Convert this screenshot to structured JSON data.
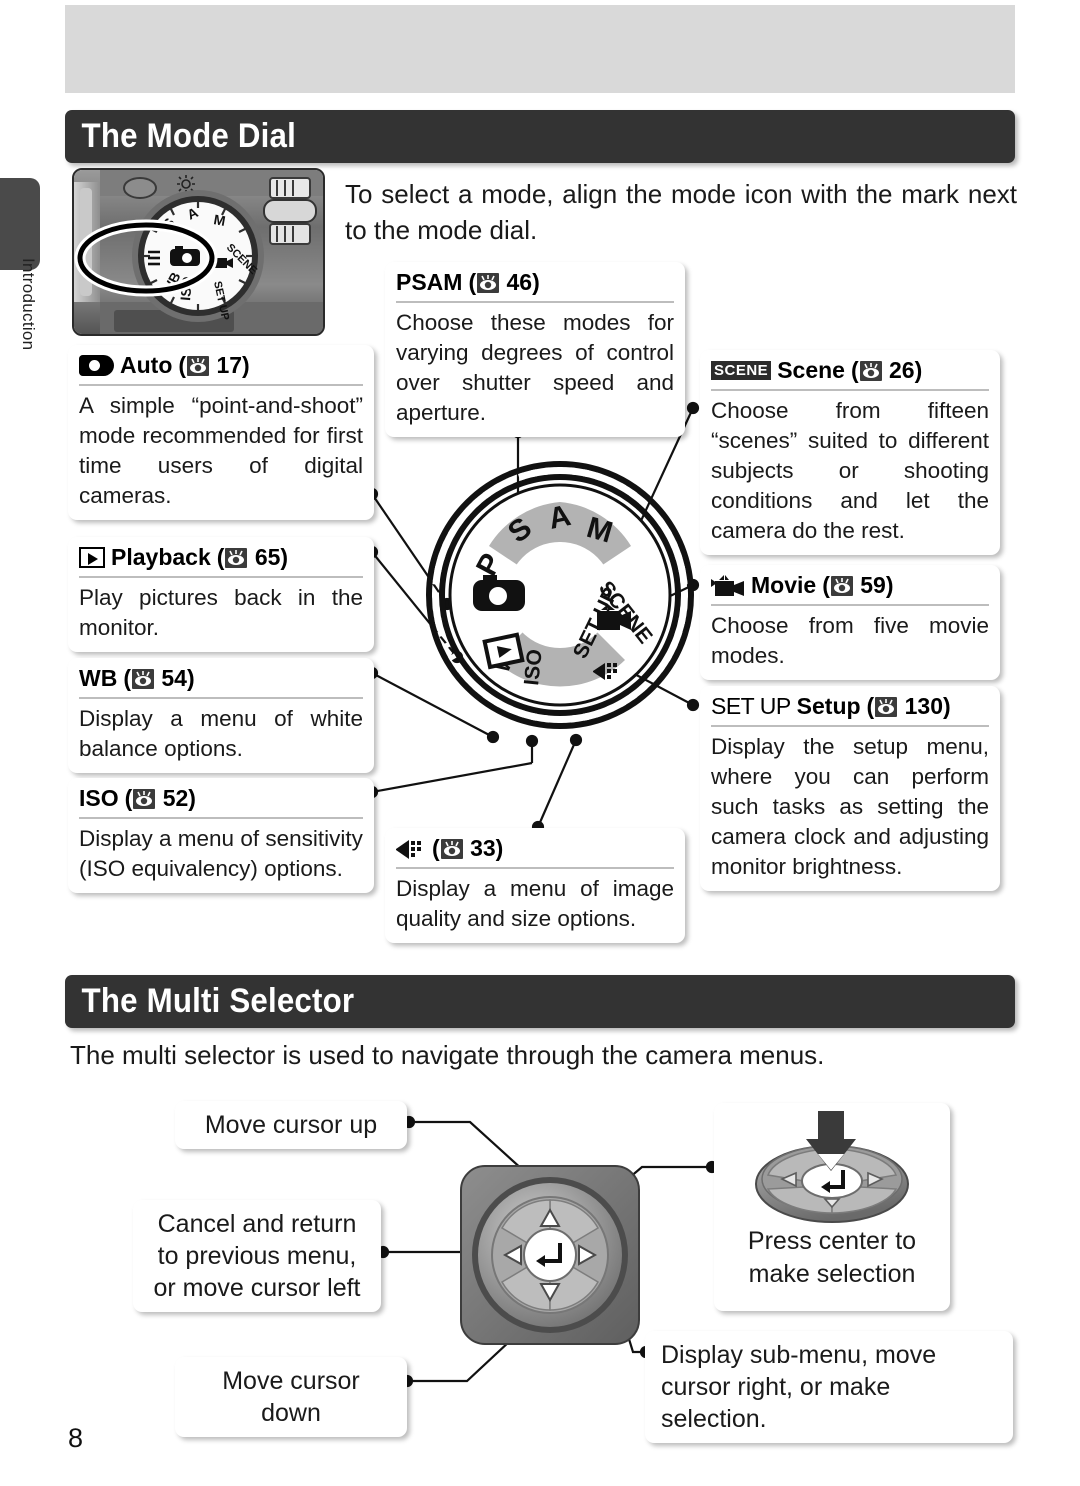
{
  "page": {
    "number": "8",
    "side_label": "Introduction"
  },
  "sections": [
    {
      "id": "mode-dial",
      "title": "The Mode Dial"
    },
    {
      "id": "multi-selector",
      "title": "The Multi Selector"
    }
  ],
  "mode_dial": {
    "intro": "To select a mode, align the mode icon with the mark next to the mode dial.",
    "dial_labels": [
      "P",
      "S",
      "A",
      "M",
      "SCENE",
      "SET UP",
      "WB",
      "ISO"
    ],
    "callouts": [
      {
        "key": "auto",
        "icon": "auto-camera-icon",
        "title": "Auto",
        "page_ref": "17",
        "body": "A simple “point-and-shoot” mode recommended for first time users of digital cameras."
      },
      {
        "key": "playback",
        "icon": "playback-icon",
        "title": "Playback",
        "page_ref": "65",
        "body": "Play pictures back in the monitor."
      },
      {
        "key": "wb",
        "icon": "",
        "title": "WB",
        "page_ref": "54",
        "body": "Display a menu of white balance options."
      },
      {
        "key": "iso",
        "icon": "",
        "title": "ISO",
        "page_ref": "52",
        "body": "Display a menu of sensitivity (ISO equivalency) options."
      },
      {
        "key": "psam",
        "icon": "",
        "title": "PSAM",
        "page_ref": "46",
        "body": "Choose these modes for varying degrees of control over shutter speed and aperture."
      },
      {
        "key": "quality",
        "icon": "image-quality-icon",
        "title": "",
        "page_ref": "33",
        "body": "Display a menu of image quality and size options."
      },
      {
        "key": "scene",
        "icon": "scene-icon",
        "title": "Scene",
        "page_ref": "26",
        "body": "Choose from fifteen “scenes” suited to different subjects or shooting conditions and let the camera do the rest."
      },
      {
        "key": "movie",
        "icon": "movie-camera-icon",
        "title": "Movie",
        "page_ref": "59",
        "body": "Choose from five movie modes."
      },
      {
        "key": "setup",
        "icon": "set-up-icon",
        "title": "Setup",
        "page_ref": "130",
        "body": "Display the setup menu, where you can perform such tasks as setting the camera clock and adjusting monitor brightness."
      }
    ],
    "scene_badge": "SCENE",
    "setup_badge": "SET UP"
  },
  "multi_selector": {
    "intro": "The multi selector is used to navigate through the camera menus.",
    "callouts": {
      "up": "Move cursor up",
      "left": "Cancel and return to previous menu, or move cursor left",
      "down": "Move cursor down",
      "right": "Display sub-menu, move cursor right, or make selection.",
      "center": "Press center to make selection"
    }
  },
  "colors": {
    "header_bar": "#333333",
    "top_band": "#d9d9d9",
    "rule": "#bdbdbd",
    "dial_gray": "#b3b3b3",
    "text": "#1a1a1a"
  }
}
